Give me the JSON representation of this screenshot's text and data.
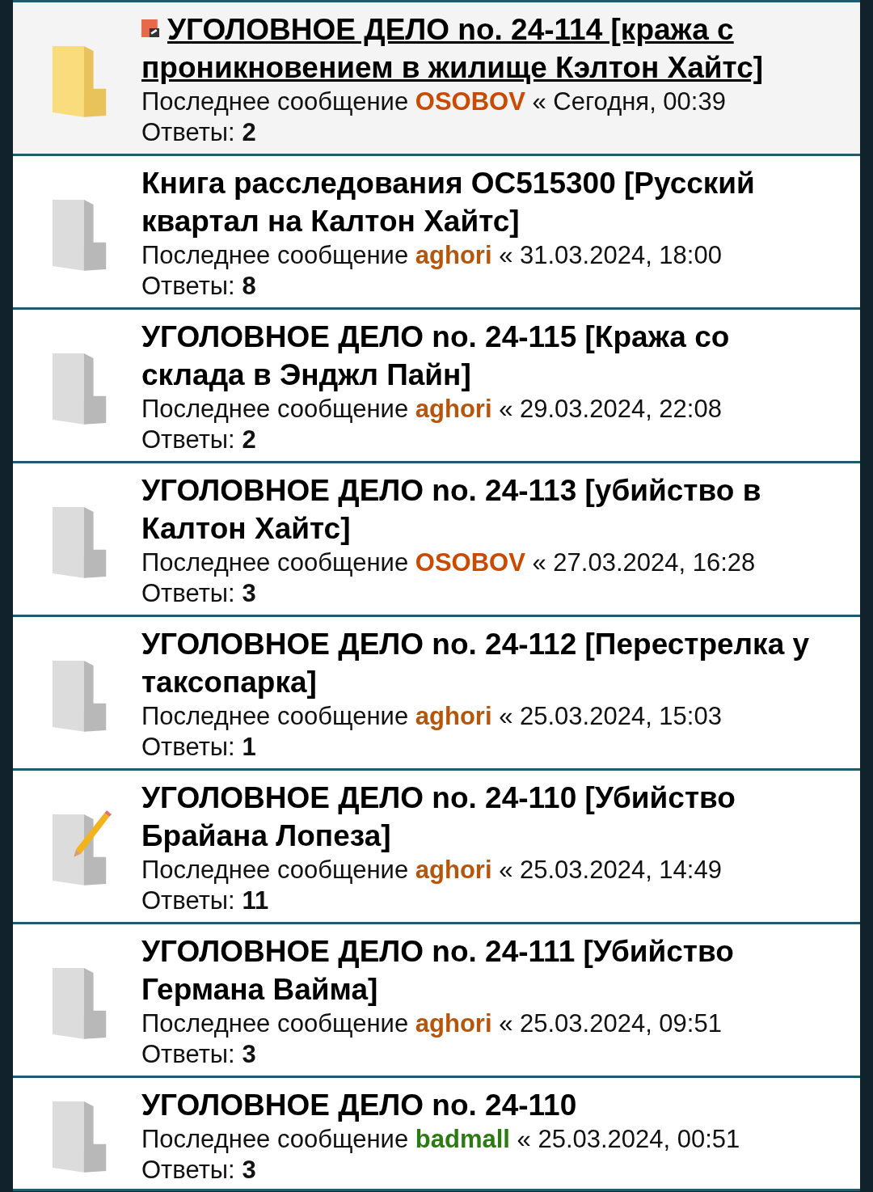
{
  "topics": [
    {
      "kind": "new",
      "new_post_marker": true,
      "title": "УГОЛОВНОЕ ДЕЛО no. 24-114 [кража с проникновением в жилище Кэлтон Хайтс]",
      "last_post_label": "Последнее сообщение",
      "author": "OSOBOV",
      "color": "#c94a00",
      "date": "« Сегодня, 00:39",
      "replies_label": "Ответы:",
      "replies": "2"
    },
    {
      "kind": "normal",
      "new_post_marker": false,
      "title": "Книга расследования OC515300 [Русский квартал на Калтон Хайтс]",
      "last_post_label": "Последнее сообщение",
      "author": "aghori",
      "color": "#b5560c",
      "date": "« 31.03.2024, 18:00",
      "replies_label": "Ответы:",
      "replies": "8"
    },
    {
      "kind": "normal",
      "new_post_marker": false,
      "title": "УГОЛОВНОЕ ДЕЛО no. 24-115 [Кража со склада в Энджл Пайн]",
      "last_post_label": "Последнее сообщение",
      "author": "aghori",
      "color": "#b5560c",
      "date": "« 29.03.2024, 22:08",
      "replies_label": "Ответы:",
      "replies": "2"
    },
    {
      "kind": "normal",
      "new_post_marker": false,
      "title": "УГОЛОВНОЕ ДЕЛО no. 24-113 [убийство в Калтон Хайтс]",
      "last_post_label": "Последнее сообщение",
      "author": "OSOBOV",
      "color": "#c94a00",
      "date": "« 27.03.2024, 16:28",
      "replies_label": "Ответы:",
      "replies": "3"
    },
    {
      "kind": "normal",
      "new_post_marker": false,
      "title": "УГОЛОВНОЕ ДЕЛО no. 24-112 [Перестрелка у таксопарка]",
      "last_post_label": "Последнее сообщение",
      "author": "aghori",
      "color": "#b5560c",
      "date": "« 25.03.2024, 15:03",
      "replies_label": "Ответы:",
      "replies": "1"
    },
    {
      "kind": "edit",
      "new_post_marker": false,
      "title": "УГОЛОВНОЕ ДЕЛО no. 24-110 [Убийство Брайана Лопеза]",
      "last_post_label": "Последнее сообщение",
      "author": "aghori",
      "color": "#b5560c",
      "date": "« 25.03.2024, 14:49",
      "replies_label": "Ответы:",
      "replies": "11"
    },
    {
      "kind": "normal",
      "new_post_marker": false,
      "title": "УГОЛОВНОЕ ДЕЛО no. 24-111 [Убийство Германа Вайма]",
      "last_post_label": "Последнее сообщение",
      "author": "aghori",
      "color": "#b5560c",
      "date": "« 25.03.2024, 09:51",
      "replies_label": "Ответы:",
      "replies": "3"
    },
    {
      "kind": "normal",
      "new_post_marker": false,
      "title": "УГОЛОВНОЕ ДЕЛО no. 24-110",
      "last_post_label": "Последнее сообщение",
      "author": "badmall",
      "color": "#2c7a12",
      "date": "« 25.03.2024, 00:51",
      "replies_label": "Ответы:",
      "replies": "3"
    }
  ]
}
